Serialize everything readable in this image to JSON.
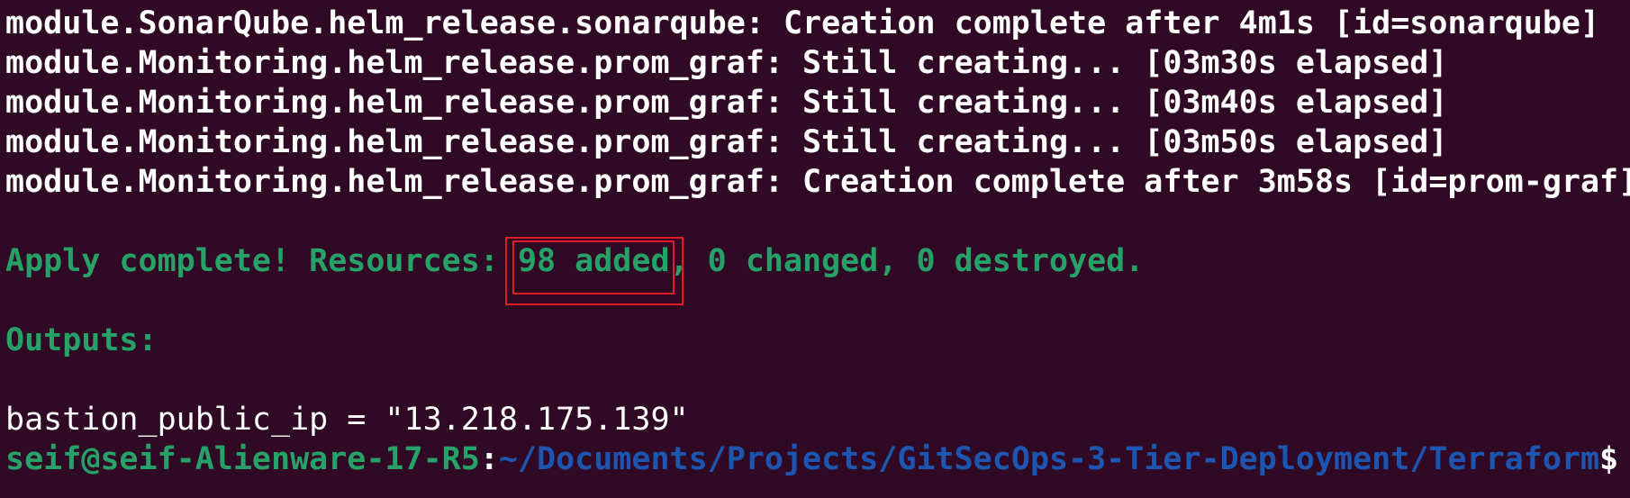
{
  "terminal": {
    "log_lines": [
      "module.SonarQube.helm_release.sonarqube: Creation complete after 4m1s [id=sonarqube]",
      "module.Monitoring.helm_release.prom_graf: Still creating... [03m30s elapsed]",
      "module.Monitoring.helm_release.prom_graf: Still creating... [03m40s elapsed]",
      "module.Monitoring.helm_release.prom_graf: Still creating... [03m50s elapsed]",
      "module.Monitoring.helm_release.prom_graf: Creation complete after 3m58s [id=prom-graf]"
    ],
    "apply": {
      "prefix": "Apply complete! Resources: ",
      "added": "98 added",
      "rest": ", 0 changed, 0 destroyed."
    },
    "outputs_header": "Outputs:",
    "output_line": "bastion_public_ip = \"13.218.175.139\"",
    "prompt": {
      "user_host": "seif@seif-Alienware-17-R5",
      "colon": ":",
      "path": "~/Documents/Projects/GitSecOps-3-Tier-Deployment/Terraform",
      "dollar": "$"
    }
  },
  "colors": {
    "background": "#300a24",
    "green": "#26a269",
    "blue": "#1c56b0",
    "highlight_box": "#e01b24"
  }
}
